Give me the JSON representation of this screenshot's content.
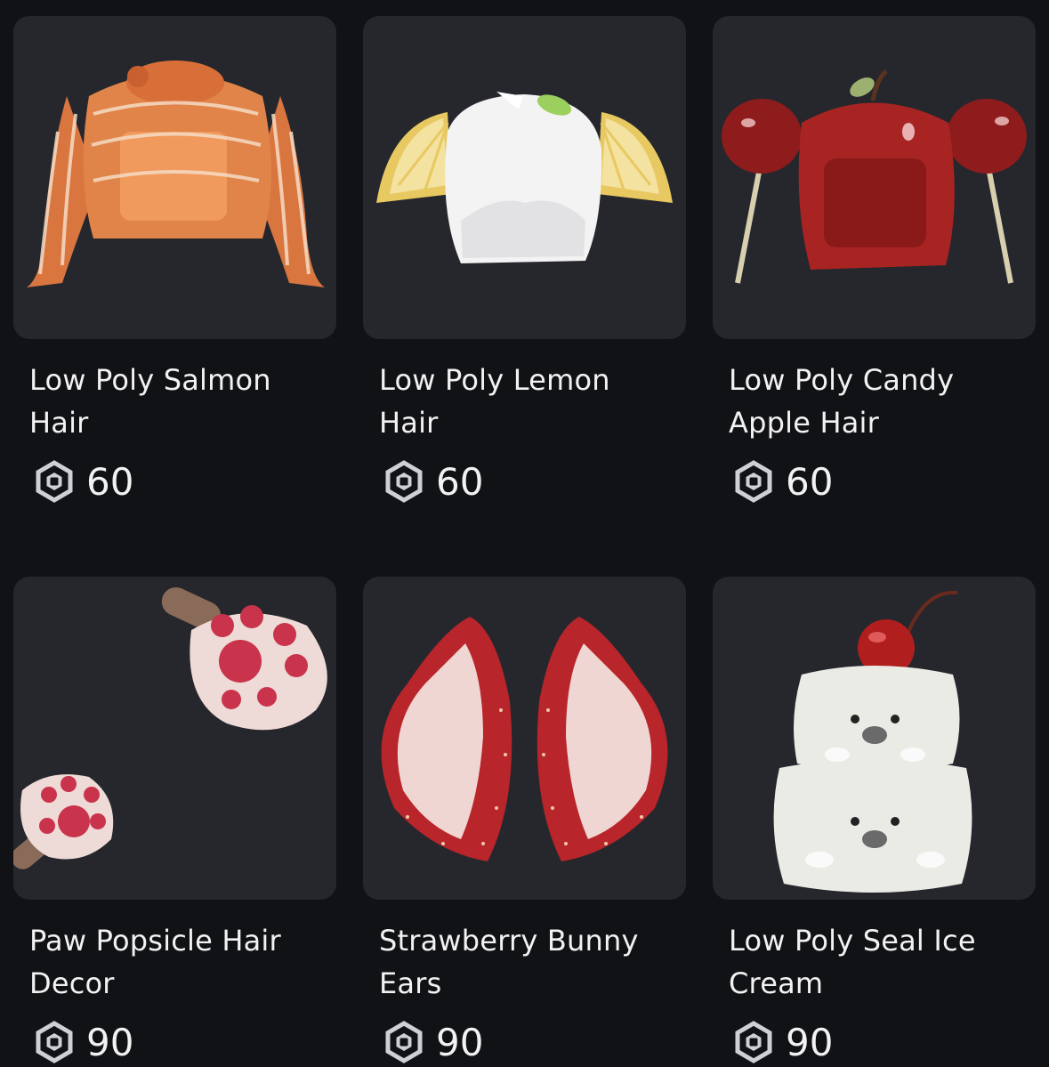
{
  "catalog": {
    "items": [
      {
        "name": "Low Poly Salmon Hair",
        "price": "60",
        "icon": "salmon-hair"
      },
      {
        "name": "Low Poly Lemon Hair",
        "price": "60",
        "icon": "lemon-hair"
      },
      {
        "name": "Low Poly Candy Apple Hair",
        "price": "60",
        "icon": "candy-apple-hair"
      },
      {
        "name": "Paw Popsicle Hair Decor",
        "price": "90",
        "icon": "paw-popsicle"
      },
      {
        "name": "Strawberry Bunny Ears",
        "price": "90",
        "icon": "strawberry-ears"
      },
      {
        "name": "Low Poly Seal Ice Cream",
        "price": "90",
        "icon": "seal-ice-cream"
      }
    ],
    "currency_icon": "robux-icon"
  },
  "colors": {
    "background": "#111216",
    "card": "#25272d",
    "text": "#f2f2f2"
  }
}
